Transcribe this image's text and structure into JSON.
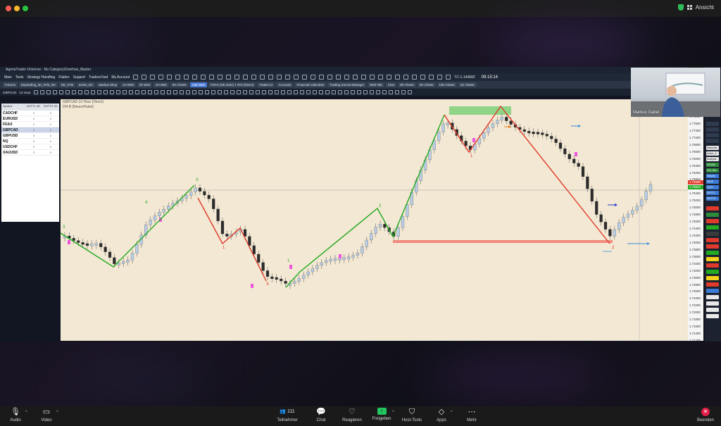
{
  "zoom": {
    "view_label": "Ansicht",
    "bottom": {
      "audio": "Audio",
      "video": "Video",
      "participants": "Teilnehmer",
      "participants_count": "111",
      "chat": "Chat",
      "react": "Reagieren",
      "share": "Freigeben",
      "host_tools": "Host-Tools",
      "apps": "Apps",
      "more": "Mehr",
      "leave": "Beenden"
    },
    "speaker_name": "Markus Gabel"
  },
  "app": {
    "title": "AgenaTrader Universe - No Category\\Dowhow_Master",
    "menu": [
      "Main",
      "Tools",
      "Strategy Handling",
      "Flatten",
      "Support",
      "TradersYard",
      "My Account"
    ],
    "account_code": "TC-1-144682",
    "clock": "09:15:14",
    "tabs": [
      "Futures",
      "Daytrading_4H_STB_Intr",
      "DE_XTB",
      "active_DC",
      "Markus Shop",
      "1H Web",
      "2h Web",
      "4H Web",
      "6H Charts",
      "H4Z Web",
      "FDAX (DE.2024) 1 Tick (Direct)",
      "Trades CI",
      "Accounts",
      "Financial Calendars",
      "Trading Journal Manager",
      "Web-Tab",
      "Chat",
      "2R Charts",
      "3H Charts",
      "10H Charts",
      "1H Charts"
    ],
    "active_tab_index": 9,
    "chart_toolbar": {
      "symbol": "GBPCAD",
      "timeframe": "12 Hour"
    }
  },
  "symbols": {
    "headers": [
      "Symbol",
      "DHTTL 4H",
      "DHTTS 4H"
    ],
    "rows": [
      {
        "name": "CADCHF",
        "a": "0",
        "b": "0"
      },
      {
        "name": "EURUSD",
        "a": "0",
        "b": "0"
      },
      {
        "name": "FDAX",
        "a": "0",
        "b": "0"
      },
      {
        "name": "GBPCAD",
        "a": "0",
        "b": "0"
      },
      {
        "name": "GBPUSD",
        "a": "0",
        "b": "0"
      },
      {
        "name": "NQ",
        "a": "0",
        "b": "0"
      },
      {
        "name": "USDCHF",
        "a": "0",
        "b": "0"
      },
      {
        "name": "XAUUSD",
        "a": "0",
        "b": "0"
      }
    ],
    "selected": "GBPCAD"
  },
  "chart": {
    "header_line1": "GBPCAD 12 Hour (Direct)",
    "header_line2": "DH-B [NeuesPaket]",
    "wave_labels": [
      "3",
      "4",
      "X",
      "1",
      "X",
      "1",
      "2",
      "1",
      "2"
    ],
    "price_axis": [
      "1.78000",
      "1.77600",
      "1.77400",
      "1.77200",
      "1.76800",
      "1.76600",
      "1.76200",
      "1.76400",
      "1.76200",
      "1.75900",
      "1.75600",
      "1.75400",
      "1.75200",
      "1.75000",
      "1.74800",
      "1.74600",
      "1.74400",
      "1.74200",
      "1.74000",
      "1.73800",
      "1.73600",
      "1.73400",
      "1.73200",
      "1.73000",
      "1.72800",
      "1.72600",
      "1.72400",
      "1.72200",
      "1.72000",
      "1.71800",
      "1.71600",
      "1.71400",
      "1.71200"
    ],
    "current_price": "1.75996",
    "current_price_2": "1.75824",
    "colors": {
      "background": "#f3e8d3",
      "bull_candle": "#b9cde4",
      "bear_candle": "#2b2b2b",
      "green_swing": "#22aa22",
      "red_swing": "#e03a2a",
      "supply_zone": "#7ed07a",
      "demand_zone": "#f08a7c"
    }
  },
  "right_panel": [
    "Watchlist",
    "active_4",
    "Analysis",
    "DH-Bar",
    "VOL Bar",
    "Volume",
    "DH-B",
    "CCIS",
    "DHTTL",
    "DHTTS"
  ]
}
